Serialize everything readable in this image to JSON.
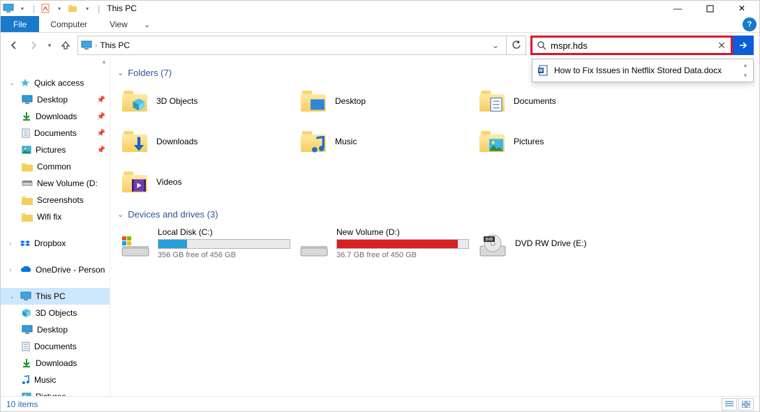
{
  "window": {
    "title": "This PC",
    "min": "—",
    "max": "▢",
    "close": "✕"
  },
  "ribbon": {
    "file": "File",
    "tabs": [
      "Computer",
      "View"
    ]
  },
  "nav": {
    "address": "This PC",
    "search_value": "mspr.hds",
    "search_suggestion": "How to Fix Issues in Netflix Stored Data.docx"
  },
  "sidebar": {
    "quick_access": "Quick access",
    "quick_items": [
      {
        "label": "Desktop",
        "icon": "desktop",
        "pinned": true
      },
      {
        "label": "Downloads",
        "icon": "downloads",
        "pinned": true
      },
      {
        "label": "Documents",
        "icon": "documents",
        "pinned": true
      },
      {
        "label": "Pictures",
        "icon": "pictures",
        "pinned": true
      },
      {
        "label": "Common",
        "icon": "folder",
        "pinned": false
      },
      {
        "label": "New Volume (D:",
        "icon": "drive",
        "pinned": false
      },
      {
        "label": "Screenshots",
        "icon": "folder",
        "pinned": false
      },
      {
        "label": "Wifi fix",
        "icon": "folder",
        "pinned": false
      }
    ],
    "dropbox": "Dropbox",
    "onedrive": "OneDrive - Person",
    "this_pc": "This PC",
    "pc_items": [
      {
        "label": "3D Objects",
        "icon": "3d"
      },
      {
        "label": "Desktop",
        "icon": "desktop"
      },
      {
        "label": "Documents",
        "icon": "documents"
      },
      {
        "label": "Downloads",
        "icon": "downloads"
      },
      {
        "label": "Music",
        "icon": "music"
      },
      {
        "label": "Pictures",
        "icon": "pictures"
      }
    ]
  },
  "content": {
    "folders_header": "Folders (7)",
    "folders": [
      {
        "label": "3D Objects",
        "icon": "3d"
      },
      {
        "label": "Desktop",
        "icon": "desktop"
      },
      {
        "label": "Documents",
        "icon": "documents"
      },
      {
        "label": "Downloads",
        "icon": "downloads"
      },
      {
        "label": "Music",
        "icon": "music"
      },
      {
        "label": "Pictures",
        "icon": "pictures"
      },
      {
        "label": "Videos",
        "icon": "videos"
      }
    ],
    "drives_header": "Devices and drives (3)",
    "drives": [
      {
        "label": "Local Disk (C:)",
        "free": "356 GB free of 456 GB",
        "fill": 22,
        "color": "#26a0da",
        "icon": "windisk"
      },
      {
        "label": "New Volume (D:)",
        "free": "36.7 GB free of 450 GB",
        "fill": 92,
        "color": "#d62222",
        "icon": "disk"
      },
      {
        "label": "DVD RW Drive (E:)",
        "free": "",
        "fill": -1,
        "color": "",
        "icon": "dvd"
      }
    ]
  },
  "status": {
    "count": "10 items"
  }
}
